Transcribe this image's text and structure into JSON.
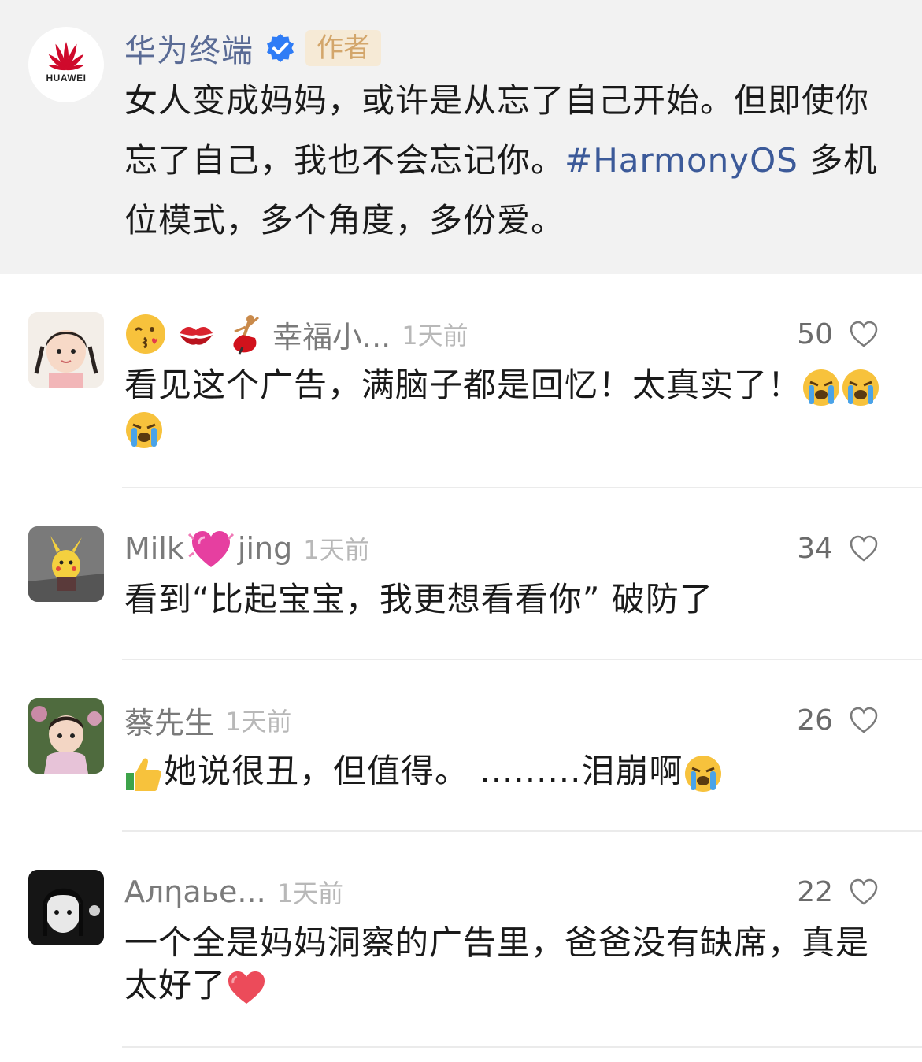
{
  "post": {
    "author_name": "华为终端",
    "author_badge": "作者",
    "author_logo_text": "HUAWEI",
    "text_main": "女人变成妈妈，或许是从忘了自己开始。但即使你忘了自己，我也不会忘记你。",
    "hashtag": "#HarmonyOS",
    "text_tail": " 多机位模式，多个角度，多份爱。"
  },
  "comments": [
    {
      "name_emojis": [
        "kissing-face-emoji",
        "kiss-mark-emoji",
        "dancer-emoji"
      ],
      "name": "幸福小...",
      "time": "1天前",
      "likes": "50",
      "text": "看见这个广告，满脑子都是回忆！太真实了！",
      "text_emojis": [
        "crying-face-emoji",
        "crying-face-emoji",
        "crying-face-emoji"
      ]
    },
    {
      "name_before": "Milk",
      "name_emoji": "sparkling-heart-emoji",
      "name_after": "jing",
      "time": "1天前",
      "likes": "34",
      "text": "看到“比起宝宝，我更想看看你” 破防了"
    },
    {
      "name": "蔡先生",
      "time": "1天前",
      "likes": "26",
      "lead_emoji": "thumbs-up-emoji",
      "text": "她说很丑，但值得。 .........泪崩啊",
      "text_emoji": "crying-face-emoji"
    },
    {
      "name": "Алηаье...",
      "time": "1天前",
      "likes": "22",
      "text": "一个全是妈妈洞察的广告里，爸爸没有缺席，真是太好了",
      "text_emoji": "red-heart-emoji"
    }
  ],
  "colors": {
    "author_bg": "#f2f2f2",
    "author_name": "#5a6b95",
    "badge_bg": "#f6ead6",
    "badge_text": "#d3a66b",
    "hashtag": "#3c5a99",
    "verified_blue": "#2f7cf6",
    "huawei_red": "#cf0a2c"
  }
}
